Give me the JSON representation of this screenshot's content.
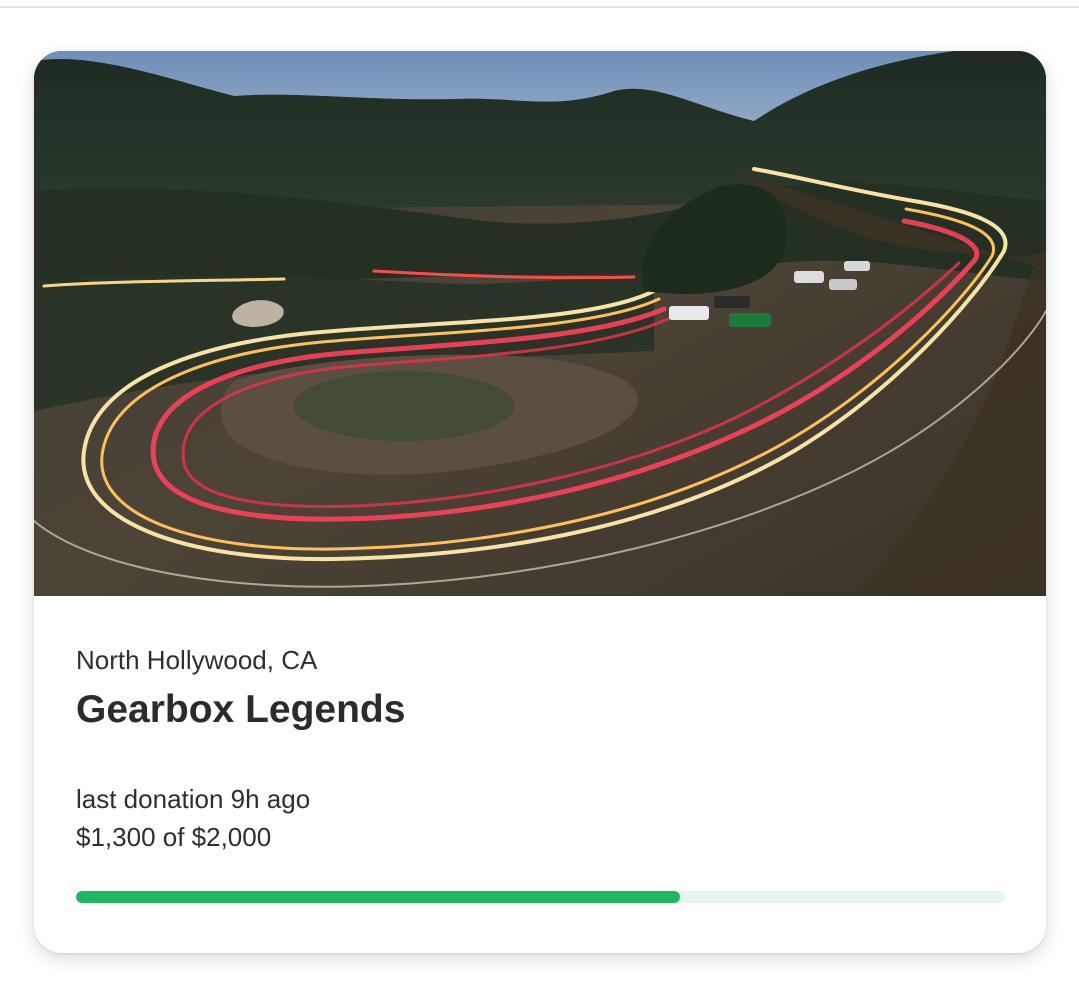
{
  "card": {
    "location": "North Hollywood, CA",
    "title": "Gearbox Legends",
    "last_donation": "last donation 9h ago",
    "amount_text": "$1,300 of $2,000",
    "raised": 1300,
    "goal": 2000,
    "progress_fraction": 0.65
  },
  "colors": {
    "progress_fill": "#1db861",
    "progress_track": "#e6f5ee",
    "text": "#2f2f2f"
  },
  "hero": {
    "subject": "night photo of winding mountain road with car light trails"
  }
}
